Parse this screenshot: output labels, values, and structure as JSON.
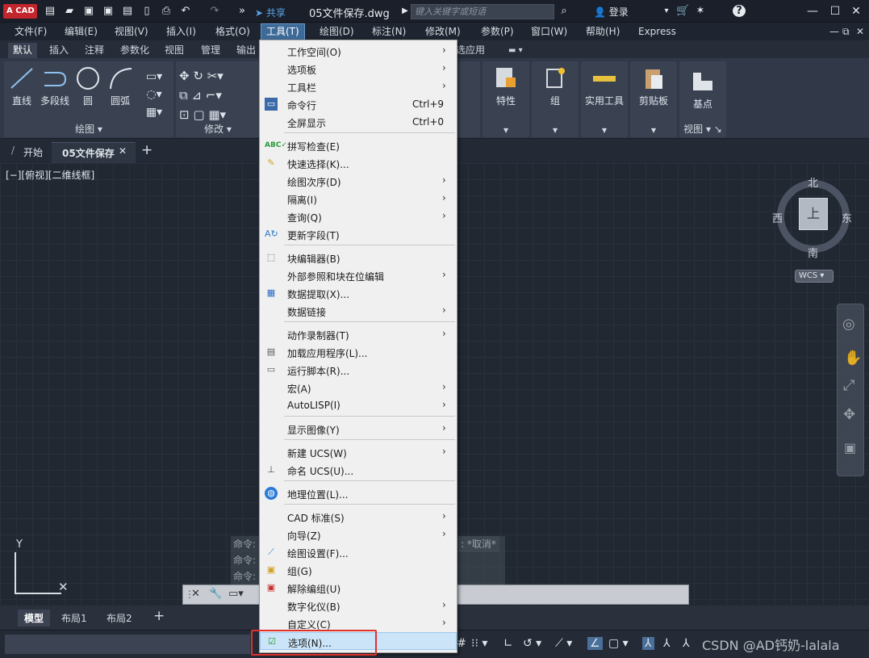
{
  "titlebar": {
    "logo": "CAD",
    "share": "共享",
    "filename": "05文件保存.dwg",
    "search_placeholder": "键入关键字或短语",
    "login": "登录"
  },
  "menubar": [
    "文件(F)",
    "编辑(E)",
    "视图(V)",
    "插入(I)",
    "格式(O)",
    "工具(T)",
    "绘图(D)",
    "标注(N)",
    "修改(M)",
    "参数(P)",
    "窗口(W)",
    "帮助(H)",
    "Express"
  ],
  "ribbon_tabs": [
    "默认",
    "插入",
    "注释",
    "参数化",
    "视图",
    "管理",
    "输出",
    "选应用"
  ],
  "ribbon": {
    "draw_tools": [
      "直线",
      "多段线",
      "圆",
      "圆弧"
    ],
    "draw_panel": "绘图",
    "modify_panel": "修改",
    "right_tools": [
      "特性",
      "组",
      "实用工具",
      "剪贴板",
      "基点"
    ],
    "view_panel": "视图"
  },
  "doc_tabs": {
    "start": "开始",
    "current": "05文件保存"
  },
  "viewport_label": "[−][俯视][二维线框]",
  "viewcube": {
    "north": "北",
    "south": "南",
    "east": "东",
    "west": "西",
    "face": "上",
    "wcs": "WCS"
  },
  "command": {
    "history": [
      "命令:",
      "命令:",
      "命令:"
    ],
    "cancel_text": "*取消*"
  },
  "layout_tabs": [
    "模型",
    "布局1",
    "布局2"
  ],
  "watermark": "CSDN @AD钙奶-lalala",
  "dropdown": [
    {
      "label": "工作空间(O)",
      "shortcut": "",
      "submenu": true
    },
    {
      "label": "选项板",
      "shortcut": "",
      "submenu": true
    },
    {
      "label": "工具栏",
      "shortcut": "",
      "submenu": true
    },
    {
      "label": "命令行",
      "shortcut": "Ctrl+9",
      "submenu": false
    },
    {
      "label": "全屏显示",
      "shortcut": "Ctrl+0",
      "submenu": false
    },
    {
      "label": "拼写检查(E)",
      "shortcut": "",
      "submenu": false
    },
    {
      "label": "快速选择(K)...",
      "shortcut": "",
      "submenu": false
    },
    {
      "label": "绘图次序(D)",
      "shortcut": "",
      "submenu": true
    },
    {
      "label": "隔离(I)",
      "shortcut": "",
      "submenu": true
    },
    {
      "label": "查询(Q)",
      "shortcut": "",
      "submenu": true
    },
    {
      "label": "更新字段(T)",
      "shortcut": "",
      "submenu": false
    },
    {
      "label": "块编辑器(B)",
      "shortcut": "",
      "submenu": false
    },
    {
      "label": "外部参照和块在位编辑",
      "shortcut": "",
      "submenu": true
    },
    {
      "label": "数据提取(X)...",
      "shortcut": "",
      "submenu": false
    },
    {
      "label": "数据链接",
      "shortcut": "",
      "submenu": true
    },
    {
      "label": "动作录制器(T)",
      "shortcut": "",
      "submenu": true
    },
    {
      "label": "加载应用程序(L)...",
      "shortcut": "",
      "submenu": false
    },
    {
      "label": "运行脚本(R)...",
      "shortcut": "",
      "submenu": false
    },
    {
      "label": "宏(A)",
      "shortcut": "",
      "submenu": true
    },
    {
      "label": "AutoLISP(I)",
      "shortcut": "",
      "submenu": true
    },
    {
      "label": "显示图像(Y)",
      "shortcut": "",
      "submenu": true
    },
    {
      "label": "新建 UCS(W)",
      "shortcut": "",
      "submenu": true
    },
    {
      "label": "命名 UCS(U)...",
      "shortcut": "",
      "submenu": false
    },
    {
      "label": "地理位置(L)...",
      "shortcut": "",
      "submenu": false
    },
    {
      "label": "CAD 标准(S)",
      "shortcut": "",
      "submenu": true
    },
    {
      "label": "向导(Z)",
      "shortcut": "",
      "submenu": true
    },
    {
      "label": "绘图设置(F)...",
      "shortcut": "",
      "submenu": false
    },
    {
      "label": "组(G)",
      "shortcut": "",
      "submenu": false
    },
    {
      "label": "解除编组(U)",
      "shortcut": "",
      "submenu": false
    },
    {
      "label": "数字化仪(B)",
      "shortcut": "",
      "submenu": true
    },
    {
      "label": "自定义(C)",
      "shortcut": "",
      "submenu": true
    },
    {
      "label": "选项(N)...",
      "shortcut": "",
      "submenu": false
    }
  ]
}
